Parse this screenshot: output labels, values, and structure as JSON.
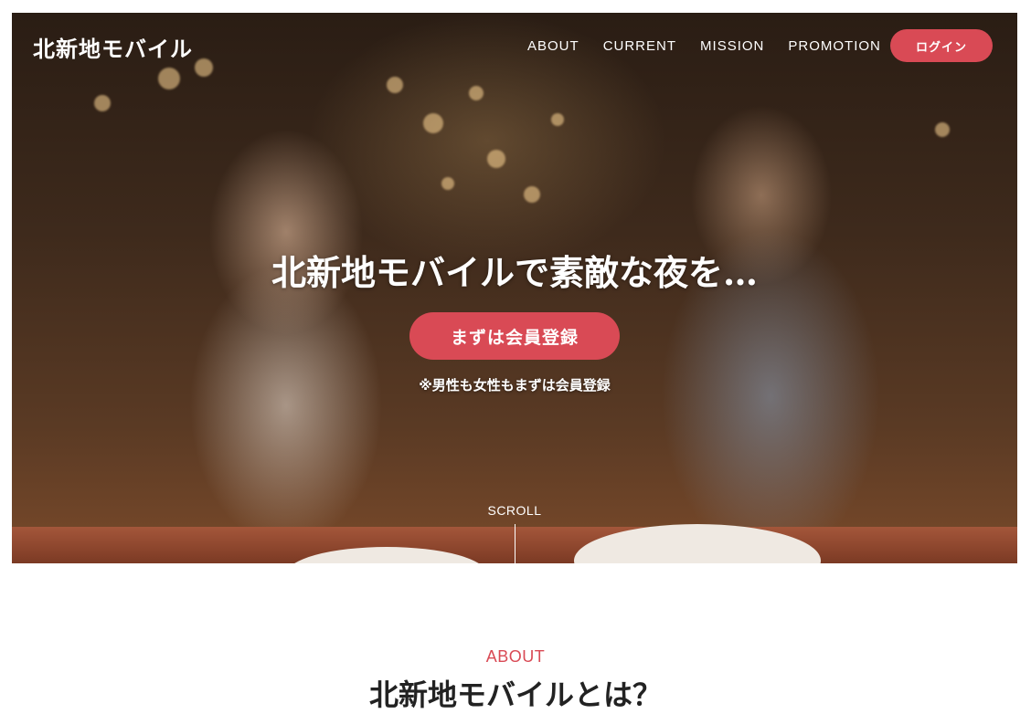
{
  "header": {
    "logo": "北新地モバイル",
    "nav": [
      "ABOUT",
      "CURRENT",
      "MISSION",
      "PROMOTION"
    ],
    "login_label": "ログイン"
  },
  "hero": {
    "headline": "北新地モバイルで素敵な夜を…",
    "cta_label": "まずは会員登録",
    "cta_note": "※男性も女性もまずは会員登録",
    "scroll_label": "SCROLL"
  },
  "about": {
    "label": "ABOUT",
    "title": "北新地モバイルとは？"
  },
  "colors": {
    "accent": "#d94a55",
    "hero_text": "#ffffff"
  }
}
